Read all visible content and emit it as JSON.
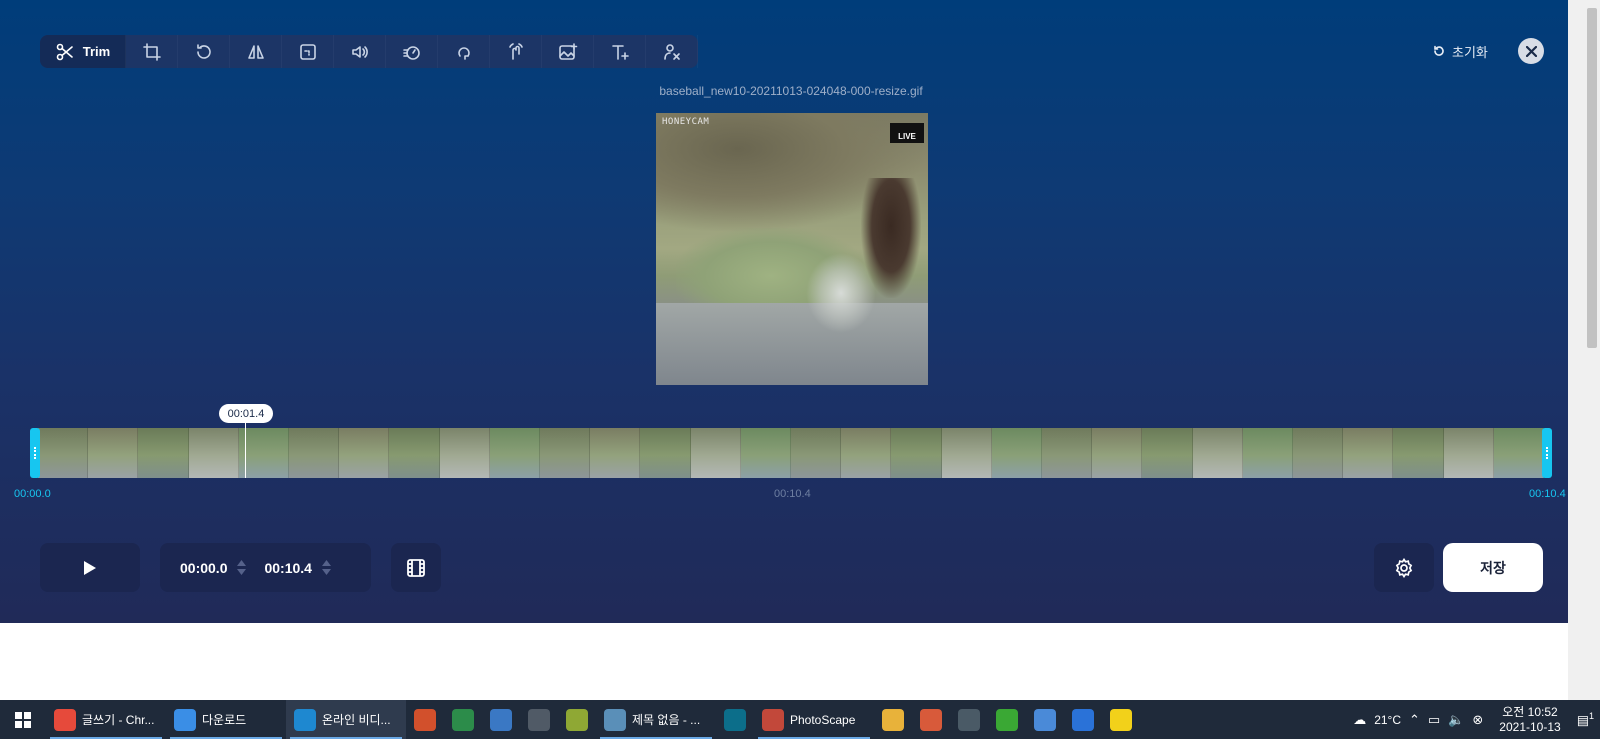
{
  "toolbar": {
    "trim_label": "Trim",
    "tools": [
      "crop-icon",
      "rotate-icon",
      "flip-icon",
      "resize-icon",
      "audio-icon",
      "speed-icon",
      "loop-icon",
      "stabilize-icon",
      "add-image-icon",
      "add-text-icon",
      "remove-watermark-icon"
    ]
  },
  "header": {
    "reset_label": "초기화",
    "filename": "baseball_new10-20211013-024048-000-resize.gif"
  },
  "preview": {
    "watermark": "HONEYCAM",
    "badge": "LIVE"
  },
  "timeline": {
    "playhead_time": "00:01.4",
    "start_time": "00:00.0",
    "mid_time": "00:10.4",
    "end_time": "00:10.4",
    "frame_count": 30,
    "accent_color": "#17c6f0"
  },
  "controls": {
    "start_value": "00:00.0",
    "end_value": "00:10.4",
    "save_label": "저장"
  },
  "taskbar": {
    "items": [
      {
        "label": "글쓰기 - Chr...",
        "icon": "chrome-icon",
        "color": "#e64a3b"
      },
      {
        "label": "다운로드",
        "icon": "download-icon",
        "color": "#3a8ee6"
      },
      {
        "label": "온라인 비디...",
        "icon": "edge-icon",
        "color": "#1e88d0"
      },
      {
        "label": "",
        "icon": "powerpoint-icon",
        "color": "#d2502c"
      },
      {
        "label": "",
        "icon": "excel-icon",
        "color": "#2c8c4a"
      },
      {
        "label": "",
        "icon": "notes-icon",
        "color": "#3a78c4"
      },
      {
        "label": "",
        "icon": "calculator-icon",
        "color": "#505a66"
      },
      {
        "label": "",
        "icon": "search-app-icon",
        "color": "#8fa834"
      },
      {
        "label": "제목 없음 - ...",
        "icon": "notepad-icon",
        "color": "#5a8fb8"
      },
      {
        "label": "",
        "icon": "mail-icon",
        "color": "#0c6e8a"
      },
      {
        "label": "PhotoScape",
        "icon": "photoscape-icon",
        "color": "#c2483a"
      },
      {
        "label": "",
        "icon": "paint-icon",
        "color": "#e8b23a"
      },
      {
        "label": "",
        "icon": "image-app-icon",
        "color": "#d85a3a"
      },
      {
        "label": "",
        "icon": "ocr-icon",
        "color": "#4a5a66"
      },
      {
        "label": "",
        "icon": "game-icon",
        "color": "#3aa834"
      },
      {
        "label": "",
        "icon": "palette-icon",
        "color": "#4a8ad8"
      },
      {
        "label": "",
        "icon": "navigator-icon",
        "color": "#2a72d8"
      },
      {
        "label": "",
        "icon": "kakaotalk-icon",
        "color": "#f2d11a"
      }
    ],
    "weather": "21°C",
    "time": "오전 10:52",
    "date": "2021-10-13",
    "notification_count": "1"
  }
}
